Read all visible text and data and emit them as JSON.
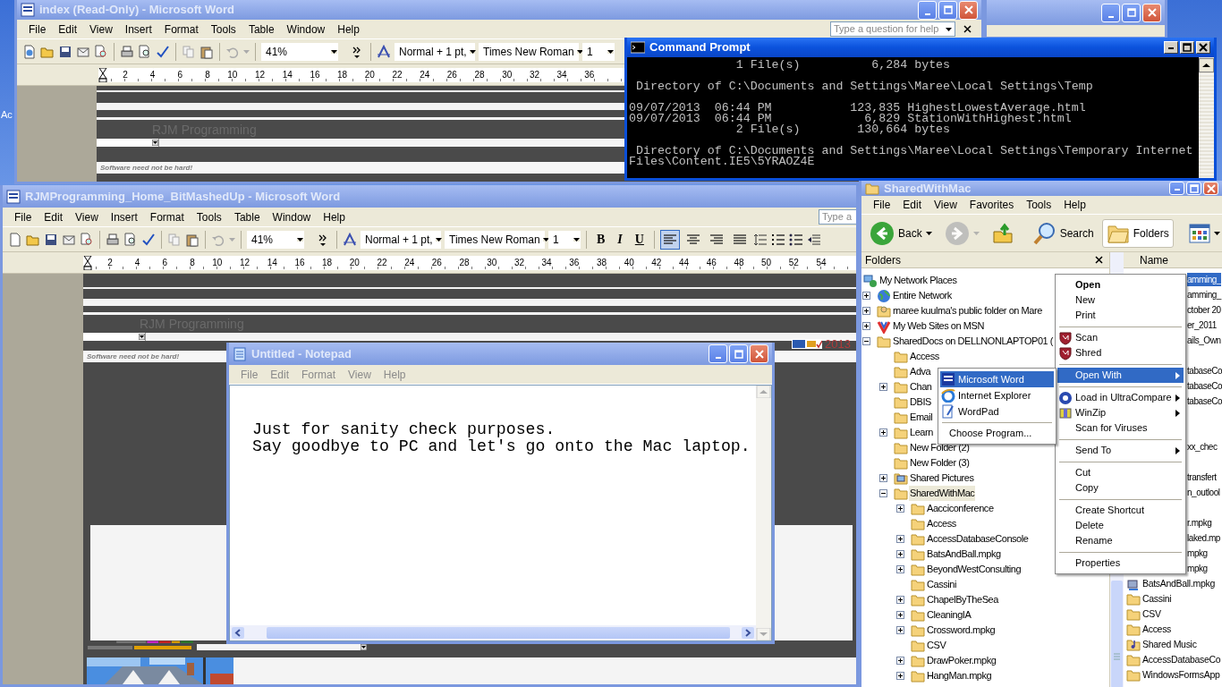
{
  "desktop": {
    "label": "Ac"
  },
  "word_windows": [
    {
      "title": "index (Read-Only) - Microsoft Word",
      "active": false,
      "menu": [
        "File",
        "Edit",
        "View",
        "Insert",
        "Format",
        "Tools",
        "Table",
        "Window",
        "Help"
      ],
      "help_placeholder": "Type a question for help",
      "zoom": "41%",
      "style": "Normal + 1 pt,",
      "font": "Times New Roman",
      "size": "1",
      "ruler": [
        "2",
        "4",
        "6",
        "8",
        "10",
        "12",
        "14",
        "16",
        "18",
        "20",
        "22",
        "24",
        "26",
        "28",
        "30",
        "32",
        "34",
        "36"
      ],
      "doc": {
        "heading": "RJM Programming",
        "tagline": "Software need not be hard!"
      }
    },
    {
      "title": "RJMProgramming_Home_BitMashedUp - Microsoft Word",
      "active": false,
      "menu": [
        "File",
        "Edit",
        "View",
        "Insert",
        "Format",
        "Tools",
        "Table",
        "Window",
        "Help"
      ],
      "help_placeholder": "Type a",
      "zoom": "41%",
      "style": "Normal + 1 pt,",
      "font": "Times New Roman",
      "size": "1",
      "format_buttons": [
        "B",
        "I",
        "U"
      ],
      "alignment": [
        {
          "selected": true
        },
        {
          "selected": false
        },
        {
          "selected": false
        },
        {
          "selected": false
        }
      ],
      "ruler": [
        "2",
        "4",
        "6",
        "8",
        "10",
        "12",
        "14",
        "16",
        "18",
        "20",
        "22",
        "24",
        "26",
        "28",
        "30",
        "32",
        "34",
        "36",
        "38",
        "40",
        "42",
        "44",
        "46",
        "48",
        "50",
        "52",
        "54"
      ],
      "doc": {
        "heading": "RJM Programming",
        "tagline": "Software need not be hard!",
        "year": "2013"
      }
    }
  ],
  "command_prompt": {
    "title": "Command Prompt",
    "active": true,
    "lines": [
      {
        "kind": "text",
        "text": "               1 File(s)          6,284 bytes"
      },
      {
        "kind": "blank"
      },
      {
        "kind": "text",
        "text": " Directory of C:\\Documents and Settings\\Maree\\Local Settings\\Temp"
      },
      {
        "kind": "blank"
      },
      {
        "kind": "text",
        "text": "09/07/2013  06:44 PM           123,835 HighestLowestAverage.html"
      },
      {
        "kind": "text",
        "text": "09/07/2013  06:44 PM             6,829 StationWithHighest.html"
      },
      {
        "kind": "text",
        "text": "               2 File(s)        130,664 bytes"
      },
      {
        "kind": "blank"
      },
      {
        "kind": "text",
        "text": " Directory of C:\\Documents and Settings\\Maree\\Local Settings\\Temporary Internet"
      },
      {
        "kind": "text",
        "text": "Files\\Content.IE5\\5YRAOZ4E"
      }
    ]
  },
  "notepad": {
    "title": "Untitled - Notepad",
    "active": false,
    "menu": [
      "File",
      "Edit",
      "Format",
      "View",
      "Help"
    ],
    "lines": [
      "Just for sanity check purposes.",
      "Say goodbye to PC and let's go onto the Mac laptop."
    ]
  },
  "explorer": {
    "title": "SharedWithMac",
    "active": false,
    "menu": [
      "File",
      "Edit",
      "View",
      "Favorites",
      "Tools",
      "Help"
    ],
    "toolbar": [
      {
        "kind": "back",
        "label": "Back",
        "disabled": false
      },
      {
        "kind": "forward",
        "disabled": true
      },
      {
        "kind": "up"
      },
      {
        "kind": "search",
        "label": "Search"
      },
      {
        "kind": "folders",
        "label": "Folders",
        "pressed": true
      },
      {
        "kind": "views"
      }
    ],
    "folders_title": "Folders",
    "name_header": "Name",
    "tree": [
      {
        "label": "My Network Places",
        "kind": "network",
        "selected": false,
        "children": [
          {
            "label": "Entire Network",
            "kind": "globe",
            "expanded": false,
            "selected": false
          },
          {
            "label": "maree kuulma's public folder on Mare",
            "kind": "shared-folder",
            "expanded": false,
            "selected": false
          },
          {
            "label": "My Web Sites on MSN",
            "kind": "web",
            "expanded": false,
            "selected": false
          },
          {
            "label": "SharedDocs on DELLNONLAPTOP01 (",
            "kind": "folder",
            "expanded": true,
            "selected": false,
            "children": [
              {
                "label": "Access",
                "kind": "folder",
                "selected": false
              },
              {
                "label": "Adva",
                "kind": "folder",
                "selected": false
              },
              {
                "label": "Chan",
                "kind": "folder",
                "expanded": false,
                "selected": false
              },
              {
                "label": "DBIS",
                "kind": "folder",
                "selected": false
              },
              {
                "label": "Email",
                "kind": "folder",
                "selected": false
              },
              {
                "label": "Learn",
                "kind": "folder",
                "expanded": false,
                "selected": false
              },
              {
                "label": "New Folder (2)",
                "kind": "folder",
                "selected": false
              },
              {
                "label": "New Folder (3)",
                "kind": "folder",
                "selected": false
              },
              {
                "label": "Shared Pictures",
                "kind": "pictures",
                "expanded": false,
                "selected": false
              },
              {
                "label": "SharedWithMac",
                "kind": "folder",
                "expanded": true,
                "selected": true,
                "children": [
                  {
                    "label": "Aacciconference",
                    "kind": "folder",
                    "expanded": false,
                    "selected": false
                  },
                  {
                    "label": "Access",
                    "kind": "folder",
                    "selected": false
                  },
                  {
                    "label": "AccessDatabaseConsole",
                    "kind": "folder",
                    "expanded": false,
                    "selected": false
                  },
                  {
                    "label": "BatsAndBall.mpkg",
                    "kind": "folder",
                    "expanded": false,
                    "selected": false
                  },
                  {
                    "label": "BeyondWestConsulting",
                    "kind": "folder",
                    "expanded": false,
                    "selected": false
                  },
                  {
                    "label": "Cassini",
                    "kind": "folder",
                    "selected": false
                  },
                  {
                    "label": "ChapelByTheSea",
                    "kind": "folder",
                    "expanded": false,
                    "selected": false
                  },
                  {
                    "label": "CleaningIA",
                    "kind": "folder",
                    "expanded": false,
                    "selected": false
                  },
                  {
                    "label": "Crossword.mpkg",
                    "kind": "folder",
                    "expanded": false,
                    "selected": false
                  },
                  {
                    "label": "CSV",
                    "kind": "folder",
                    "selected": false
                  },
                  {
                    "label": "DrawPoker.mpkg",
                    "kind": "folder",
                    "expanded": false,
                    "selected": false
                  },
                  {
                    "label": "HangMan.mpkg",
                    "kind": "folder",
                    "expanded": false,
                    "selected": false
                  }
                ]
              }
            ]
          }
        ]
      }
    ],
    "files": [
      {
        "kind": "fragment",
        "text": "amming_",
        "selected": true
      },
      {
        "kind": "fragment",
        "text": "amming_",
        "selected": false
      },
      {
        "kind": "fragment",
        "text": "ctober 20",
        "selected": false
      },
      {
        "kind": "fragment",
        "text": "er_2011",
        "selected": false
      },
      {
        "kind": "fragment",
        "text": "ails_Own",
        "selected": false
      },
      {
        "kind": "blank"
      },
      {
        "kind": "fragment",
        "text": "tabaseCo",
        "selected": false
      },
      {
        "kind": "fragment",
        "text": "tabaseCo",
        "selected": false
      },
      {
        "kind": "fragment",
        "text": "tabaseCo",
        "selected": false
      },
      {
        "kind": "blank"
      },
      {
        "kind": "blank"
      },
      {
        "kind": "fragment",
        "text": "xx_chec",
        "selected": false
      },
      {
        "kind": "blank"
      },
      {
        "kind": "fragment",
        "text": "transfert",
        "selected": false
      },
      {
        "kind": "fragment",
        "text": "n_outlool",
        "selected": false
      },
      {
        "kind": "blank"
      },
      {
        "kind": "fragment",
        "text": "r.mpkg",
        "selected": false
      },
      {
        "kind": "fragment",
        "text": "laked.mp",
        "selected": false
      },
      {
        "kind": "fragment",
        "text": "mpkg",
        "selected": false
      },
      {
        "kind": "fragment",
        "text": "mpkg",
        "selected": false
      },
      {
        "kind": "package",
        "text": "BatsAndBall.mpkg",
        "selected": false
      },
      {
        "kind": "folder",
        "text": "Cassini",
        "selected": false
      },
      {
        "kind": "folder",
        "text": "CSV",
        "selected": false
      },
      {
        "kind": "folder",
        "text": "Access",
        "selected": false
      },
      {
        "kind": "music",
        "text": "Shared Music",
        "selected": false
      },
      {
        "kind": "folder",
        "text": "AccessDatabaseCo",
        "selected": false
      },
      {
        "kind": "folder",
        "text": "WindowsFormsApp",
        "selected": false
      }
    ]
  },
  "context_menu": {
    "items": [
      {
        "kind": "plain",
        "label": "Open",
        "default": true,
        "submenu": false,
        "selected": false
      },
      {
        "kind": "plain",
        "label": "New",
        "default": false,
        "submenu": false,
        "selected": false
      },
      {
        "kind": "plain",
        "label": "Print",
        "default": false,
        "submenu": false,
        "selected": false
      },
      {
        "kind": "separator"
      },
      {
        "kind": "shield",
        "label": "Scan",
        "default": false,
        "submenu": false,
        "selected": false
      },
      {
        "kind": "shield",
        "label": "Shred",
        "default": false,
        "submenu": false,
        "selected": false
      },
      {
        "kind": "separator"
      },
      {
        "kind": "plain",
        "label": "Open With",
        "default": false,
        "submenu": true,
        "selected": true
      },
      {
        "kind": "separator"
      },
      {
        "kind": "compare",
        "label": "Load in UltraCompare",
        "default": false,
        "submenu": true,
        "selected": false
      },
      {
        "kind": "zip",
        "label": "WinZip",
        "default": false,
        "submenu": true,
        "selected": false
      },
      {
        "kind": "plain",
        "label": "Scan for Viruses",
        "default": false,
        "submenu": false,
        "selected": false
      },
      {
        "kind": "separator"
      },
      {
        "kind": "plain",
        "label": "Send To",
        "default": false,
        "submenu": true,
        "selected": false
      },
      {
        "kind": "separator"
      },
      {
        "kind": "plain",
        "label": "Cut",
        "default": false,
        "submenu": false,
        "selected": false
      },
      {
        "kind": "plain",
        "label": "Copy",
        "default": false,
        "submenu": false,
        "selected": false
      },
      {
        "kind": "separator"
      },
      {
        "kind": "plain",
        "label": "Create Shortcut",
        "default": false,
        "submenu": false,
        "selected": false
      },
      {
        "kind": "plain",
        "label": "Delete",
        "default": false,
        "submenu": false,
        "selected": false
      },
      {
        "kind": "plain",
        "label": "Rename",
        "default": false,
        "submenu": false,
        "selected": false
      },
      {
        "kind": "separator"
      },
      {
        "kind": "plain",
        "label": "Properties",
        "default": false,
        "submenu": false,
        "selected": false
      }
    ]
  },
  "open_with_menu": {
    "items": [
      {
        "kind": "word",
        "label": "Microsoft Word",
        "selected": true
      },
      {
        "kind": "ie",
        "label": "Internet Explorer",
        "selected": false
      },
      {
        "kind": "wordpad",
        "label": "WordPad",
        "selected": false
      },
      {
        "kind": "separator"
      },
      {
        "kind": "plain",
        "label": "Choose Program...",
        "selected": false
      }
    ]
  }
}
